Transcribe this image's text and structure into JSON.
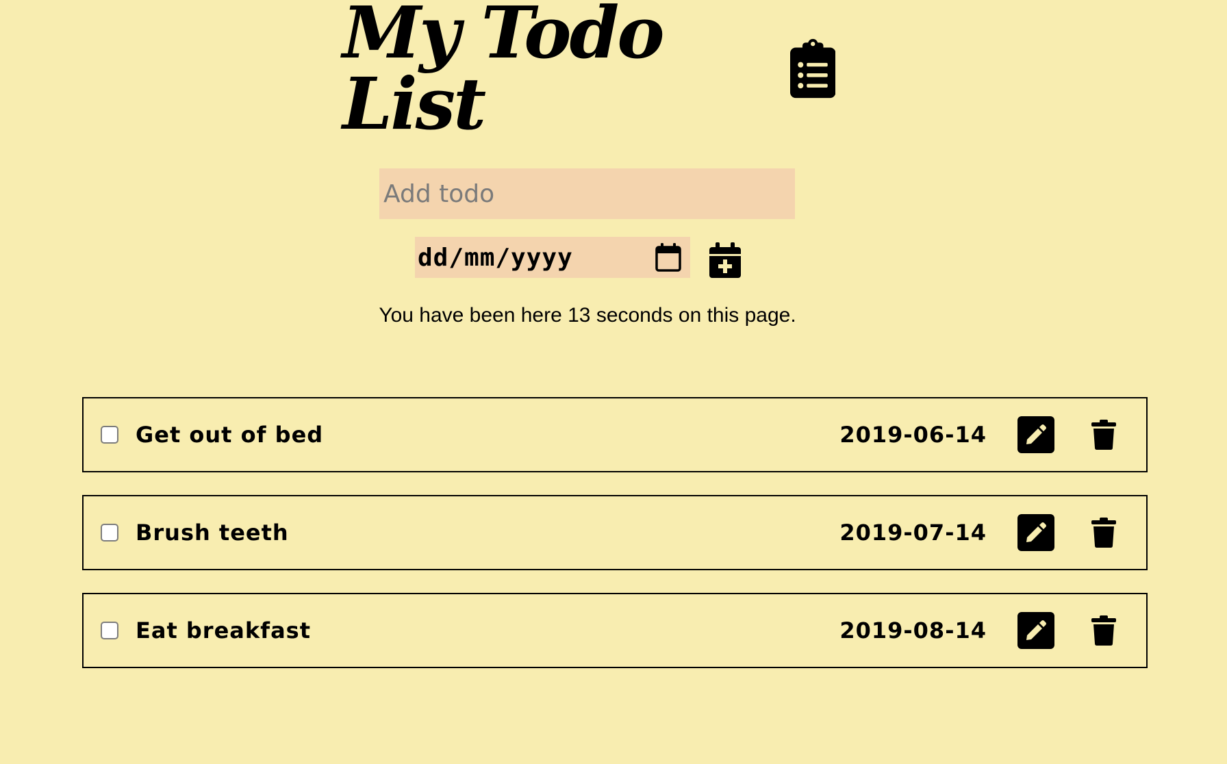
{
  "header": {
    "title": "My Todo List",
    "icon": "clipboard-list-icon"
  },
  "add_form": {
    "todo_placeholder": "Add todo",
    "date_placeholder": "dd/mm/yyyy",
    "calendar_icon": "calendar-icon",
    "add_button_icon": "calendar-plus-icon"
  },
  "timer_text": "You have been here 13 seconds on this page.",
  "todos": [
    {
      "text": "Get out of bed",
      "date": "2019-06-14",
      "checked": false
    },
    {
      "text": "Brush teeth",
      "date": "2019-07-14",
      "checked": false
    },
    {
      "text": "Eat breakfast",
      "date": "2019-08-14",
      "checked": false
    }
  ],
  "colors": {
    "background": "#f8edb0",
    "input_background": "#f4d4ae",
    "text": "#000000"
  }
}
